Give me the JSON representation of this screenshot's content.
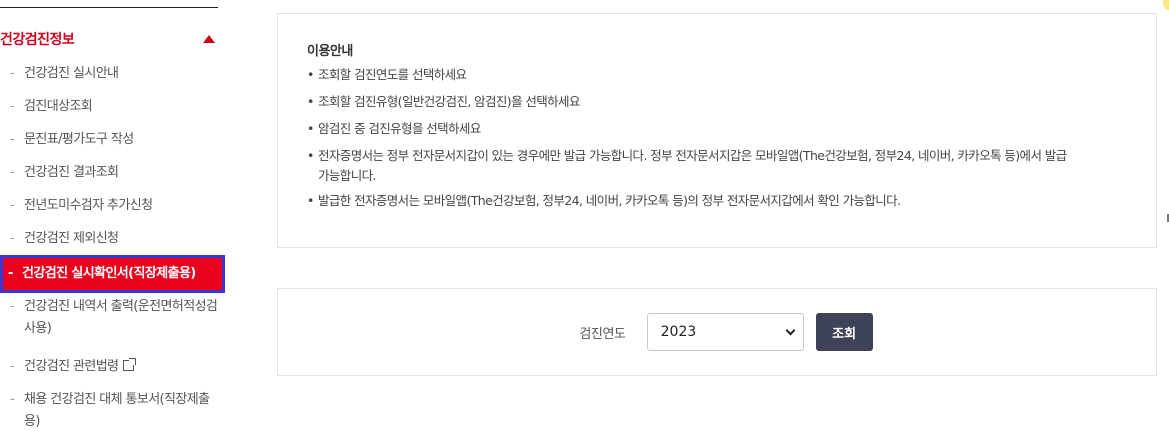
{
  "sidebar": {
    "section_title": "건강검진정보",
    "items": [
      {
        "label": "건강검진 실시안내"
      },
      {
        "label": "검진대상조회"
      },
      {
        "label": "문진표/평가도구 작성"
      },
      {
        "label": "건강검진 결과조회"
      },
      {
        "label": "전년도미수검자 추가신청"
      },
      {
        "label": "건강검진 제외신청"
      },
      {
        "label": "건강검진 실시확인서(직장제출용)"
      },
      {
        "label": "건강검진 내역서 출력(운전면허적성검사용)"
      },
      {
        "label": "건강검진 관련법령"
      },
      {
        "label": "채용 건강검진 대체 통보서(직장제출용)"
      }
    ]
  },
  "guide": {
    "title": "이용안내",
    "items": [
      "조회할 검진연도를 선택하세요",
      "조회할 검진유형(일반건강검진, 암검진)을 선택하세요",
      "암검진 중 검진유형을 선택하세요",
      "전자증명서는 정부 전자문서지갑이 있는 경우에만 발급 가능합니다. 정부 전자문서지갑은 모바일앱(The건강보험, 정부24, 네이버, 카카오톡 등)에서 발급 가능합니다.",
      "발급한 전자증명서는 모바일앱(The건강보험, 정부24, 네이버, 카카오톡 등)의 정부 전자문서지갑에서 확인 가능합니다."
    ]
  },
  "search": {
    "label": "검진연도",
    "selected_year": "2023",
    "button_label": "조회"
  },
  "colors": {
    "accent_red": "#e8001c",
    "active_outline": "#3a36d6",
    "button_bg": "#3f4357"
  }
}
